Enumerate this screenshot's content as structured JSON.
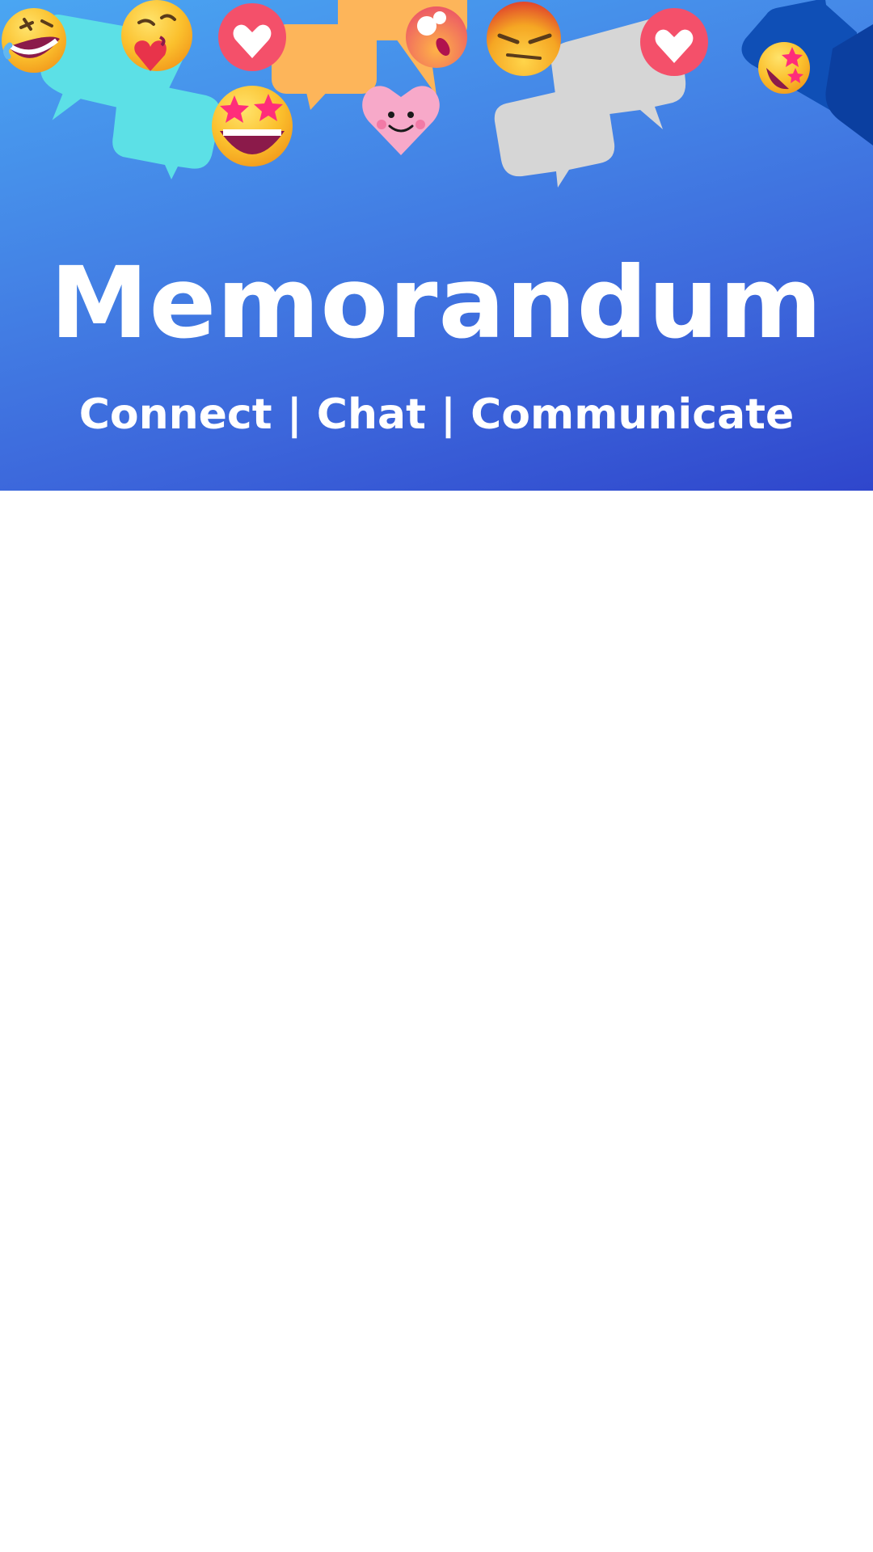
{
  "header": {
    "title": "Memorandum",
    "tagline": "Connect | Chat | Communicate"
  },
  "decorations": {
    "icons": [
      "rolling-laughing-emoji-icon",
      "kissing-heart-emoji-icon",
      "heart-icon",
      "star-struck-emoji-icon",
      "smiling-heart-icon",
      "shocked-emoji-icon",
      "unamused-emoji-icon",
      "chat-bubble-icon"
    ]
  },
  "colors": {
    "gradient_start": "#4aa6f2",
    "gradient_end": "#2f46cc",
    "text": "#ffffff",
    "bubble_cyan": "#5ce0e6",
    "bubble_orange": "#fdb55a",
    "bubble_grey": "#d6d6d6",
    "bubble_navy": "#0f4fb6",
    "heart_red": "#f4506a",
    "heart_pink": "#f7a9c9"
  }
}
